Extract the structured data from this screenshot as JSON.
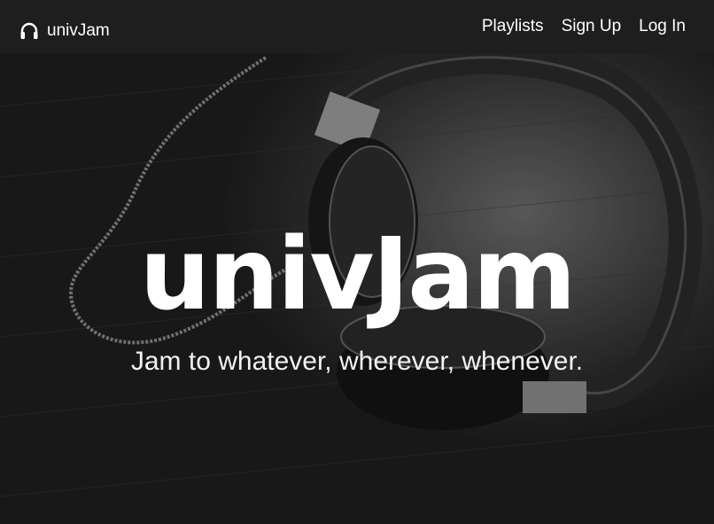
{
  "navbar": {
    "brand_label": "univJam",
    "brand_icon": "headphones-icon",
    "links": [
      {
        "label": "Playlists"
      },
      {
        "label": "Sign Up"
      },
      {
        "label": "Log In"
      }
    ]
  },
  "hero": {
    "title": "univJam",
    "subtitle": "Jam to whatever, wherever, whenever.",
    "background_image": "headphones-on-wooden-table-photo"
  },
  "colors": {
    "navbar_bg": "#1e1e1e",
    "text": "#ffffff"
  }
}
